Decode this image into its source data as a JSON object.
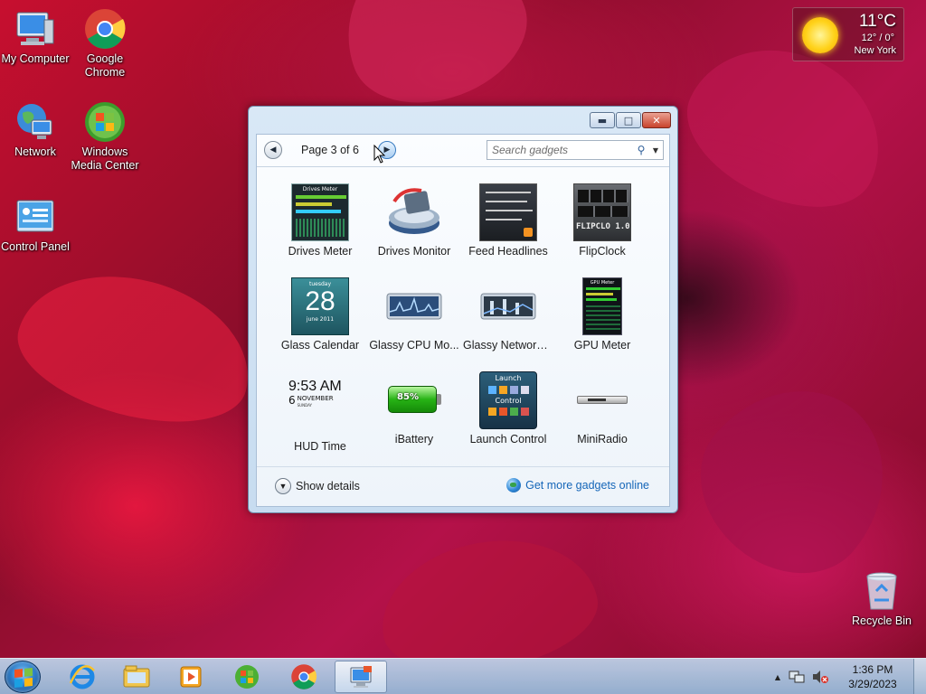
{
  "desktop": {
    "icons": [
      {
        "label": "My Computer",
        "icon": "computer-icon"
      },
      {
        "label": "Google Chrome",
        "icon": "chrome-icon"
      },
      {
        "label": "Network",
        "icon": "network-icon"
      },
      {
        "label": "Windows Media Center",
        "icon": "media-center-icon"
      },
      {
        "label": "Control Panel",
        "icon": "control-panel-icon"
      },
      {
        "label": "Recycle Bin",
        "icon": "recycle-bin-icon"
      }
    ]
  },
  "weather": {
    "temperature": "11°C",
    "range": "12° / 0°",
    "city": "New York",
    "icon": "sun-icon"
  },
  "gadget_window": {
    "page_label": "Page 3 of 6",
    "search_placeholder": "Search gadgets",
    "gadgets": [
      {
        "label": "Drives Meter",
        "icon": "drives-meter-icon"
      },
      {
        "label": "Drives Monitor",
        "icon": "drives-monitor-icon"
      },
      {
        "label": "Feed Headlines",
        "icon": "feed-headlines-icon"
      },
      {
        "label": "FlipClock",
        "icon": "flipclock-icon"
      },
      {
        "label": "Glass Calendar",
        "icon": "glass-calendar-icon"
      },
      {
        "label": "Glassy CPU Mo...",
        "icon": "glassy-cpu-icon"
      },
      {
        "label": "Glassy Network ...",
        "icon": "glassy-network-icon"
      },
      {
        "label": "GPU Meter",
        "icon": "gpu-meter-icon"
      },
      {
        "label": "HUD Time",
        "icon": "hud-time-icon"
      },
      {
        "label": "iBattery",
        "icon": "ibattery-icon"
      },
      {
        "label": "Launch Control",
        "icon": "launch-control-icon"
      },
      {
        "label": "MiniRadio",
        "icon": "miniradio-icon"
      }
    ],
    "thumb_text": {
      "drives_meter_title": "Drives Meter",
      "flipclock_digits": "FLIPCLO 1.0",
      "calendar_day_name": "tuesday",
      "calendar_day": "28",
      "calendar_month": "june 2011",
      "hud_time": "9:53 AM",
      "hud_date_num": "6",
      "hud_month": "NOVEMBER",
      "hud_weekday": "SUNDAY",
      "battery_percent": "85%",
      "launch_title": "Launch",
      "launch_sub": "Control",
      "gpu_title": "GPU Meter"
    },
    "footer": {
      "show_details": "Show details",
      "get_more": "Get more gadgets online"
    }
  },
  "taskbar": {
    "apps": [
      "internet-explorer-icon",
      "explorer-icon",
      "media-player-icon",
      "media-center-icon",
      "chrome-icon",
      "gadgets-icon"
    ],
    "clock_time": "1:36 PM",
    "clock_date": "3/29/2023"
  }
}
